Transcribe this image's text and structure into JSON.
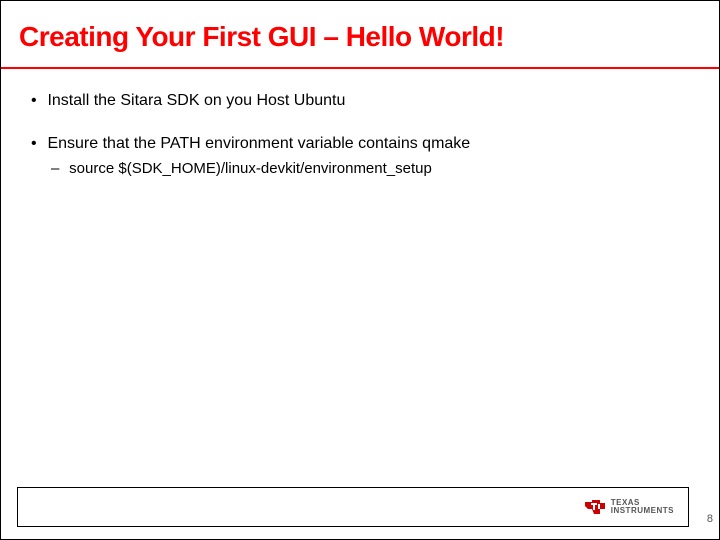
{
  "title": "Creating Your First GUI – Hello World!",
  "bullets": [
    {
      "text": "Install the Sitara SDK on you Host Ubuntu",
      "sub": []
    },
    {
      "text": "Ensure that the PATH environment variable contains qmake",
      "sub": [
        {
          "text": "source $(SDK_HOME)/linux-devkit/environment_setup"
        }
      ]
    }
  ],
  "logo": {
    "line1": "TEXAS",
    "line2": "INSTRUMENTS"
  },
  "page_number": "8"
}
